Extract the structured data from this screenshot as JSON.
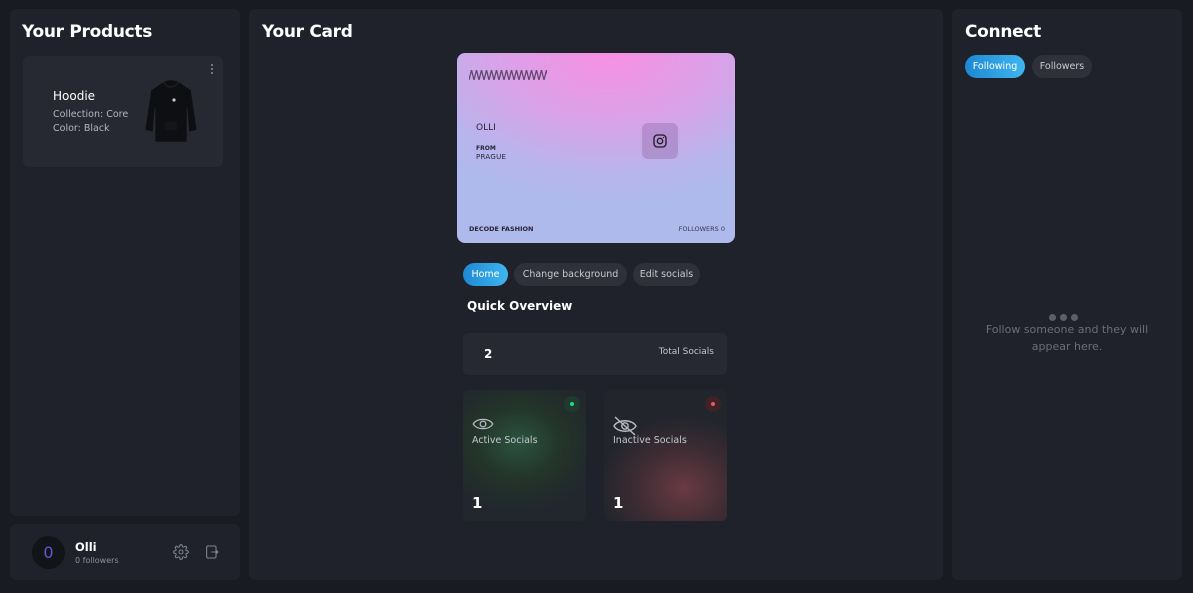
{
  "products": {
    "title": "Your Products",
    "items": [
      {
        "name": "Hoodie",
        "collection": "Collection: Core",
        "color": "Color: Black"
      }
    ]
  },
  "user": {
    "avatar_initial": "0",
    "name": "Olli",
    "followers": "0 followers"
  },
  "card_section": {
    "title": "Your Card",
    "card": {
      "name": "OLLI",
      "from_label": "FROM",
      "location": "PRAGUE",
      "brand": "DECODE FASHION",
      "followers": "FOLLOWERS 0"
    },
    "tabs": [
      {
        "label": "Home",
        "active": true
      },
      {
        "label": "Change background",
        "active": false
      },
      {
        "label": "Edit socials",
        "active": false
      }
    ],
    "overview_title": "Quick Overview",
    "total_socials": {
      "value": "2",
      "label": "Total Socials"
    },
    "active_socials": {
      "label": "Active Socials",
      "value": "1",
      "color": "#2bd28a"
    },
    "inactive_socials": {
      "label": "Inactive Socials",
      "value": "1",
      "color": "#f0565f"
    }
  },
  "connect": {
    "title": "Connect",
    "tabs": [
      {
        "label": "Following",
        "active": true
      },
      {
        "label": "Followers",
        "active": false
      }
    ],
    "empty_message": "Follow someone and they will appear here."
  }
}
